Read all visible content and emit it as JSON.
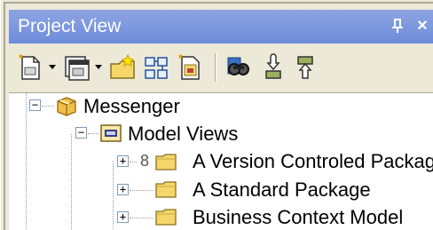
{
  "window": {
    "title": "Project View",
    "pin_glyph": "ᵖ",
    "close_glyph": "×"
  },
  "toolbar": {
    "items": [
      {
        "name": "new-element-icon"
      },
      {
        "name": "new-diagram-icon"
      },
      {
        "name": "new-package-icon"
      },
      {
        "name": "new-view-icon"
      },
      {
        "name": "add-package-icon"
      },
      {
        "name": "find-icon"
      },
      {
        "name": "check-in-icon"
      },
      {
        "name": "check-out-icon"
      }
    ]
  },
  "tree": {
    "nodes": [
      {
        "label": "Messenger",
        "expander": "−",
        "icon": "model-root-icon"
      },
      {
        "label": "Model Views",
        "expander": "−",
        "icon": "model-views-icon"
      },
      {
        "label": "A Version Controled Package",
        "expander": "+",
        "icon": "package-folder-icon",
        "prefix": "8"
      },
      {
        "label": "A Standard Package",
        "expander": "+",
        "icon": "package-folder-icon"
      },
      {
        "label": "Business Context Model",
        "expander": "+",
        "icon": "package-folder-icon"
      }
    ]
  },
  "colors": {
    "titlebar": "#7a96df",
    "panel_bg": "#ece9d8",
    "folder_yellow": "#f5d66b"
  }
}
